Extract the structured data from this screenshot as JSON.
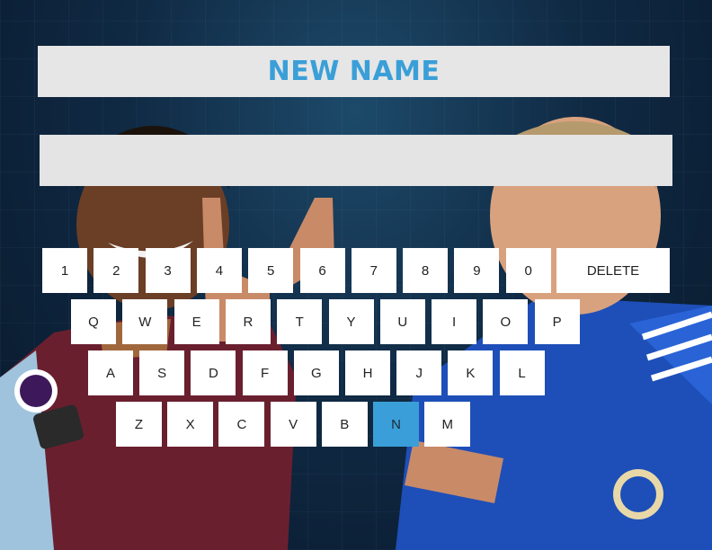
{
  "header": {
    "title": "NEW NAME"
  },
  "name_input": {
    "value": ""
  },
  "keyboard": {
    "row_numbers": [
      "1",
      "2",
      "3",
      "4",
      "5",
      "6",
      "7",
      "8",
      "9",
      "0"
    ],
    "delete_label": "DELETE",
    "row_top": [
      "Q",
      "W",
      "E",
      "R",
      "T",
      "Y",
      "U",
      "I",
      "O",
      "P"
    ],
    "row_middle": [
      "A",
      "S",
      "D",
      "F",
      "G",
      "H",
      "J",
      "K",
      "L"
    ],
    "row_bottom": [
      "Z",
      "X",
      "C",
      "V",
      "B",
      "N",
      "M"
    ],
    "selected_key": "N"
  },
  "colors": {
    "accent": "#3a9fd8",
    "panel": "#e6e6e6",
    "key": "#ffffff"
  }
}
